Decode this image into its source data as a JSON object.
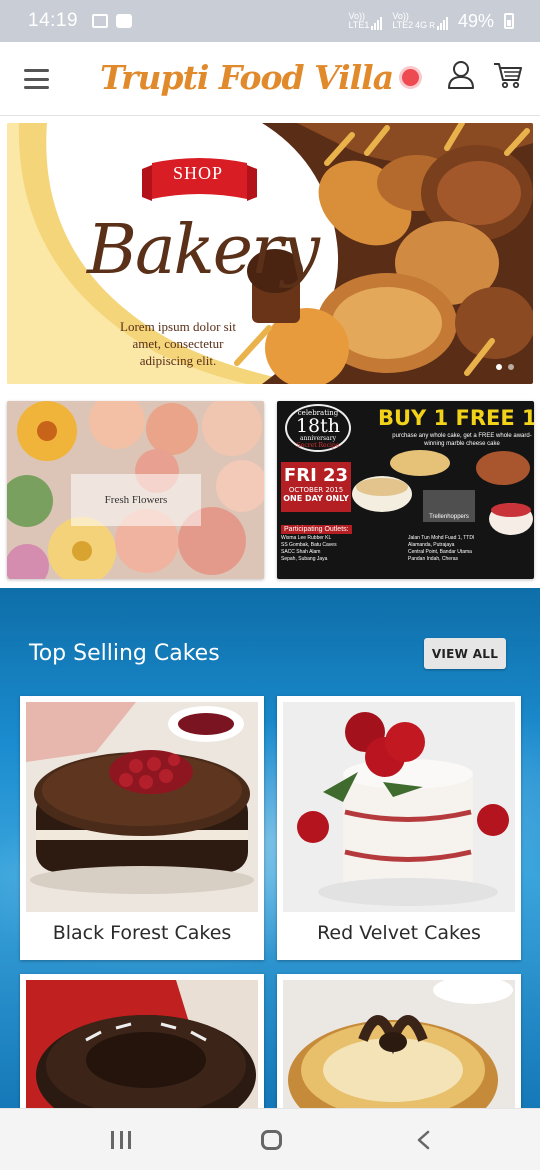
{
  "status_bar": {
    "time": "14:19",
    "sim1_label": "Vo))\nLTE1",
    "sim2_label": "Vo))\nLTE2",
    "network": "4G",
    "roaming": "R",
    "battery": "49%"
  },
  "header": {
    "brand": "Trupti Food Villa",
    "icons": [
      "hamburger-menu-icon",
      "notification-dot",
      "user-icon",
      "cart-icon"
    ],
    "brand_color": "#e08a2c"
  },
  "hero_banner": {
    "ribbon_text": "SHOP",
    "title": "Bakery",
    "subtitle": "Lorem ipsum dolor sit amet, consectetur adipiscing elit.",
    "slide_count": 2,
    "active_slide": 1
  },
  "promos": {
    "flowers_label": "Fresh Flowers",
    "offer": {
      "celebrating": "celebrating",
      "anniversary_number": "18th",
      "anniversary": "anniversary",
      "secret_recipe": "Secret Recipe",
      "title": "BUY 1 FREE 1",
      "description": "purchase any whole cake, get a FREE whole award-winning marble cheese cake",
      "date_day": "FRI 23",
      "date_month": "OCTOBER 2015",
      "date_note": "ONE DAY ONLY",
      "outlets_heading": "Participating Outlets:",
      "outlets": [
        "Wisma Lee Rubber KL",
        "Jalan Tun Mohd Fuad 1, TTDI",
        "SS Gombak, Batu Caves",
        "Alamanda, Putrajaya",
        "SACC Shah Alam",
        "Central Point, Bandar Utama",
        "Sepah, Subang Jaya",
        "Pandan Indah, Cheras"
      ],
      "tag": "Trellenhoppers"
    }
  },
  "top_selling": {
    "title": "Top Selling Cakes",
    "view_all": "VIEW ALL",
    "cards": [
      {
        "label": "Black Forest Cakes"
      },
      {
        "label": "Red Velvet Cakes"
      },
      {
        "label": ""
      },
      {
        "label": ""
      }
    ]
  },
  "nav_bar": {
    "icons": [
      "recent-apps-icon",
      "home-icon",
      "back-icon"
    ]
  }
}
